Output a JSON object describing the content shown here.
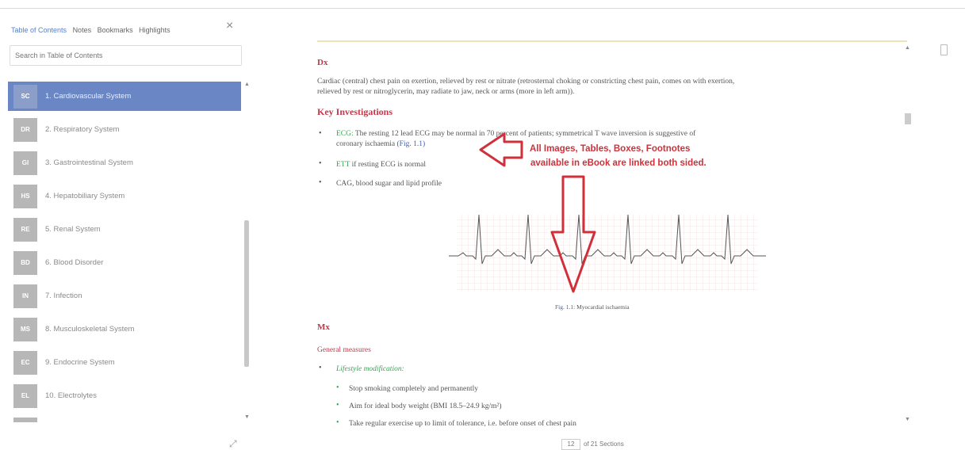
{
  "sidebar": {
    "tabs": [
      "Table of Contents",
      "Notes",
      "Bookmarks",
      "Highlights"
    ],
    "close_glyph": "×",
    "search_placeholder": "Search in Table of Contents",
    "items": [
      {
        "code": "SC",
        "label": "1. Cardiovascular System",
        "active": true
      },
      {
        "code": "DR",
        "label": "2. Respiratory System"
      },
      {
        "code": "GI",
        "label": "3. Gastrointestinal System"
      },
      {
        "code": "HS",
        "label": "4. Hepatobiliary System"
      },
      {
        "code": "RE",
        "label": "5. Renal System"
      },
      {
        "code": "BD",
        "label": "6. Blood Disorder"
      },
      {
        "code": "IN",
        "label": "7. Infection"
      },
      {
        "code": "MS",
        "label": "8. Musculoskeletal System"
      },
      {
        "code": "EC",
        "label": "9. Endocrine System"
      },
      {
        "code": "EL",
        "label": "10. Electrolytes"
      }
    ],
    "icons": {
      "close": "close-icon",
      "resize": "resize-icon"
    }
  },
  "reader": {
    "dx_heading": "Dx",
    "dx_text_1": "Cardiac (central) chest pain on exertion, relieved by rest or nitrate (retrosternal choking or constricting chest pain, comes on with exertion,",
    "dx_text_2": "relieved by rest or nitroglycerin, may radiate to jaw, neck or arms (more in left arm)).",
    "key_heading": "Key Investigations",
    "ecg_label": "ECG:",
    "ecg_text": " The resting 12 lead ECG may be normal in 70 percent of patients; symmetrical T wave inversion is suggestive of",
    "ecg_text_2": "coronary ischaemia ",
    "fig_link": "(Fig. 1.1)",
    "ett_label": "ETT",
    "ett_text": " if resting ECG is normal",
    "cag_text": "CAG, blood sugar and lipid profile",
    "figure_caption_label": "Fig. 1.1:",
    "figure_caption": " Myocardial ischaemia",
    "mx_heading": "Mx",
    "general_measures": "General measures",
    "lifestyle": "Lifestyle modification:",
    "sub_items": [
      "Stop smoking completely and permanently",
      "Aim for ideal body weight (BMI 18.5–24.9 kg/m²)",
      "Take regular exercise up to limit of tolerance, i.e. before onset of chest pain"
    ],
    "callout_line_1": "All Images, Tables, Boxes, Footnotes",
    "callout_line_2": "available in eBook are linked both sided.",
    "page_current": "12",
    "page_total": "of 21 Sections"
  },
  "colors": {
    "accent": "#6a86c4",
    "heading_red": "#c0394b",
    "link_blue": "#3b5fb5",
    "green": "#3aa353",
    "callout_red": "#d0303a"
  }
}
